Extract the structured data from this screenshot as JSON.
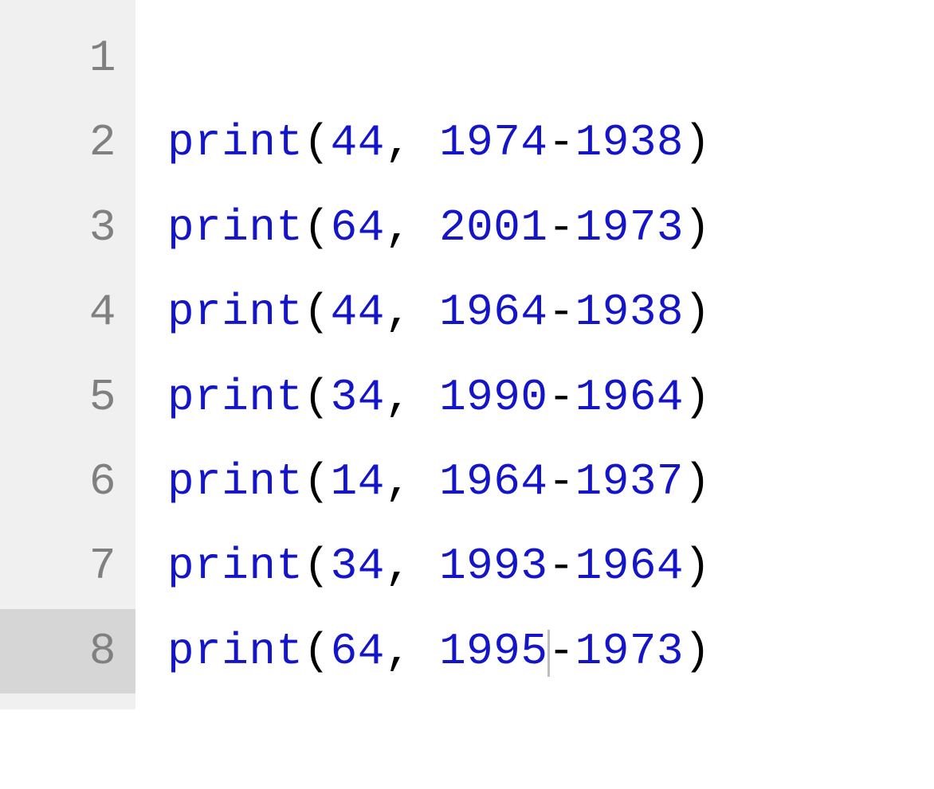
{
  "editor": {
    "currentLine": 8,
    "cursorColumn": 15,
    "lines": [
      {
        "number": "1",
        "tokens": []
      },
      {
        "number": "2",
        "tokens": [
          {
            "t": "func",
            "v": "print"
          },
          {
            "t": "punct",
            "v": "("
          },
          {
            "t": "num",
            "v": "44"
          },
          {
            "t": "punct",
            "v": ","
          },
          {
            "t": "space",
            "v": " "
          },
          {
            "t": "num",
            "v": "1974"
          },
          {
            "t": "op",
            "v": "-"
          },
          {
            "t": "num",
            "v": "1938"
          },
          {
            "t": "punct",
            "v": ")"
          }
        ]
      },
      {
        "number": "3",
        "tokens": [
          {
            "t": "func",
            "v": "print"
          },
          {
            "t": "punct",
            "v": "("
          },
          {
            "t": "num",
            "v": "64"
          },
          {
            "t": "punct",
            "v": ","
          },
          {
            "t": "space",
            "v": " "
          },
          {
            "t": "num",
            "v": "2001"
          },
          {
            "t": "op",
            "v": "-"
          },
          {
            "t": "num",
            "v": "1973"
          },
          {
            "t": "punct",
            "v": ")"
          }
        ]
      },
      {
        "number": "4",
        "tokens": [
          {
            "t": "func",
            "v": "print"
          },
          {
            "t": "punct",
            "v": "("
          },
          {
            "t": "num",
            "v": "44"
          },
          {
            "t": "punct",
            "v": ","
          },
          {
            "t": "space",
            "v": " "
          },
          {
            "t": "num",
            "v": "1964"
          },
          {
            "t": "op",
            "v": "-"
          },
          {
            "t": "num",
            "v": "1938"
          },
          {
            "t": "punct",
            "v": ")"
          }
        ]
      },
      {
        "number": "5",
        "tokens": [
          {
            "t": "func",
            "v": "print"
          },
          {
            "t": "punct",
            "v": "("
          },
          {
            "t": "num",
            "v": "34"
          },
          {
            "t": "punct",
            "v": ","
          },
          {
            "t": "space",
            "v": " "
          },
          {
            "t": "num",
            "v": "1990"
          },
          {
            "t": "op",
            "v": "-"
          },
          {
            "t": "num",
            "v": "1964"
          },
          {
            "t": "punct",
            "v": ")"
          }
        ]
      },
      {
        "number": "6",
        "tokens": [
          {
            "t": "func",
            "v": "print"
          },
          {
            "t": "punct",
            "v": "("
          },
          {
            "t": "num",
            "v": "14"
          },
          {
            "t": "punct",
            "v": ","
          },
          {
            "t": "space",
            "v": " "
          },
          {
            "t": "num",
            "v": "1964"
          },
          {
            "t": "op",
            "v": "-"
          },
          {
            "t": "num",
            "v": "1937"
          },
          {
            "t": "punct",
            "v": ")"
          }
        ]
      },
      {
        "number": "7",
        "tokens": [
          {
            "t": "func",
            "v": "print"
          },
          {
            "t": "punct",
            "v": "("
          },
          {
            "t": "num",
            "v": "34"
          },
          {
            "t": "punct",
            "v": ","
          },
          {
            "t": "space",
            "v": " "
          },
          {
            "t": "num",
            "v": "1993"
          },
          {
            "t": "op",
            "v": "-"
          },
          {
            "t": "num",
            "v": "1964"
          },
          {
            "t": "punct",
            "v": ")"
          }
        ]
      },
      {
        "number": "8",
        "tokens": [
          {
            "t": "func",
            "v": "print"
          },
          {
            "t": "punct",
            "v": "("
          },
          {
            "t": "num",
            "v": "64"
          },
          {
            "t": "punct",
            "v": ","
          },
          {
            "t": "space",
            "v": " "
          },
          {
            "t": "num",
            "v": "1995"
          },
          {
            "t": "cursor",
            "v": ""
          },
          {
            "t": "op",
            "v": "-"
          },
          {
            "t": "num",
            "v": "1973"
          },
          {
            "t": "punct",
            "v": ")"
          }
        ]
      }
    ]
  }
}
